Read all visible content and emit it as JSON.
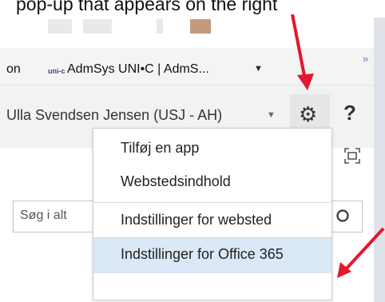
{
  "caption": {
    "text": "pop-up that appears on the right"
  },
  "favorites": {
    "prefix": "on",
    "item_icon": "uni-c-icon",
    "item_icon_text": "uni-c",
    "item_label": "AdmSys UNI•C | AdmS...",
    "more_label": "»"
  },
  "suite_bar": {
    "user_name": "Ulla Svendsen Jensen (USJ - AH)",
    "gear_icon": "gear-icon",
    "help_label": "?"
  },
  "settings_menu": {
    "items": [
      {
        "label": "Tilføj en app"
      },
      {
        "label": "Webstedsindhold"
      },
      {
        "label": "Indstillinger for websted"
      },
      {
        "label": "Indstillinger for Office 365",
        "highlighted": true
      }
    ]
  },
  "search": {
    "placeholder": "Søg i alt"
  },
  "colors": {
    "annotation_arrow": "#e5172b",
    "menu_highlight": "#dbe8f5"
  }
}
